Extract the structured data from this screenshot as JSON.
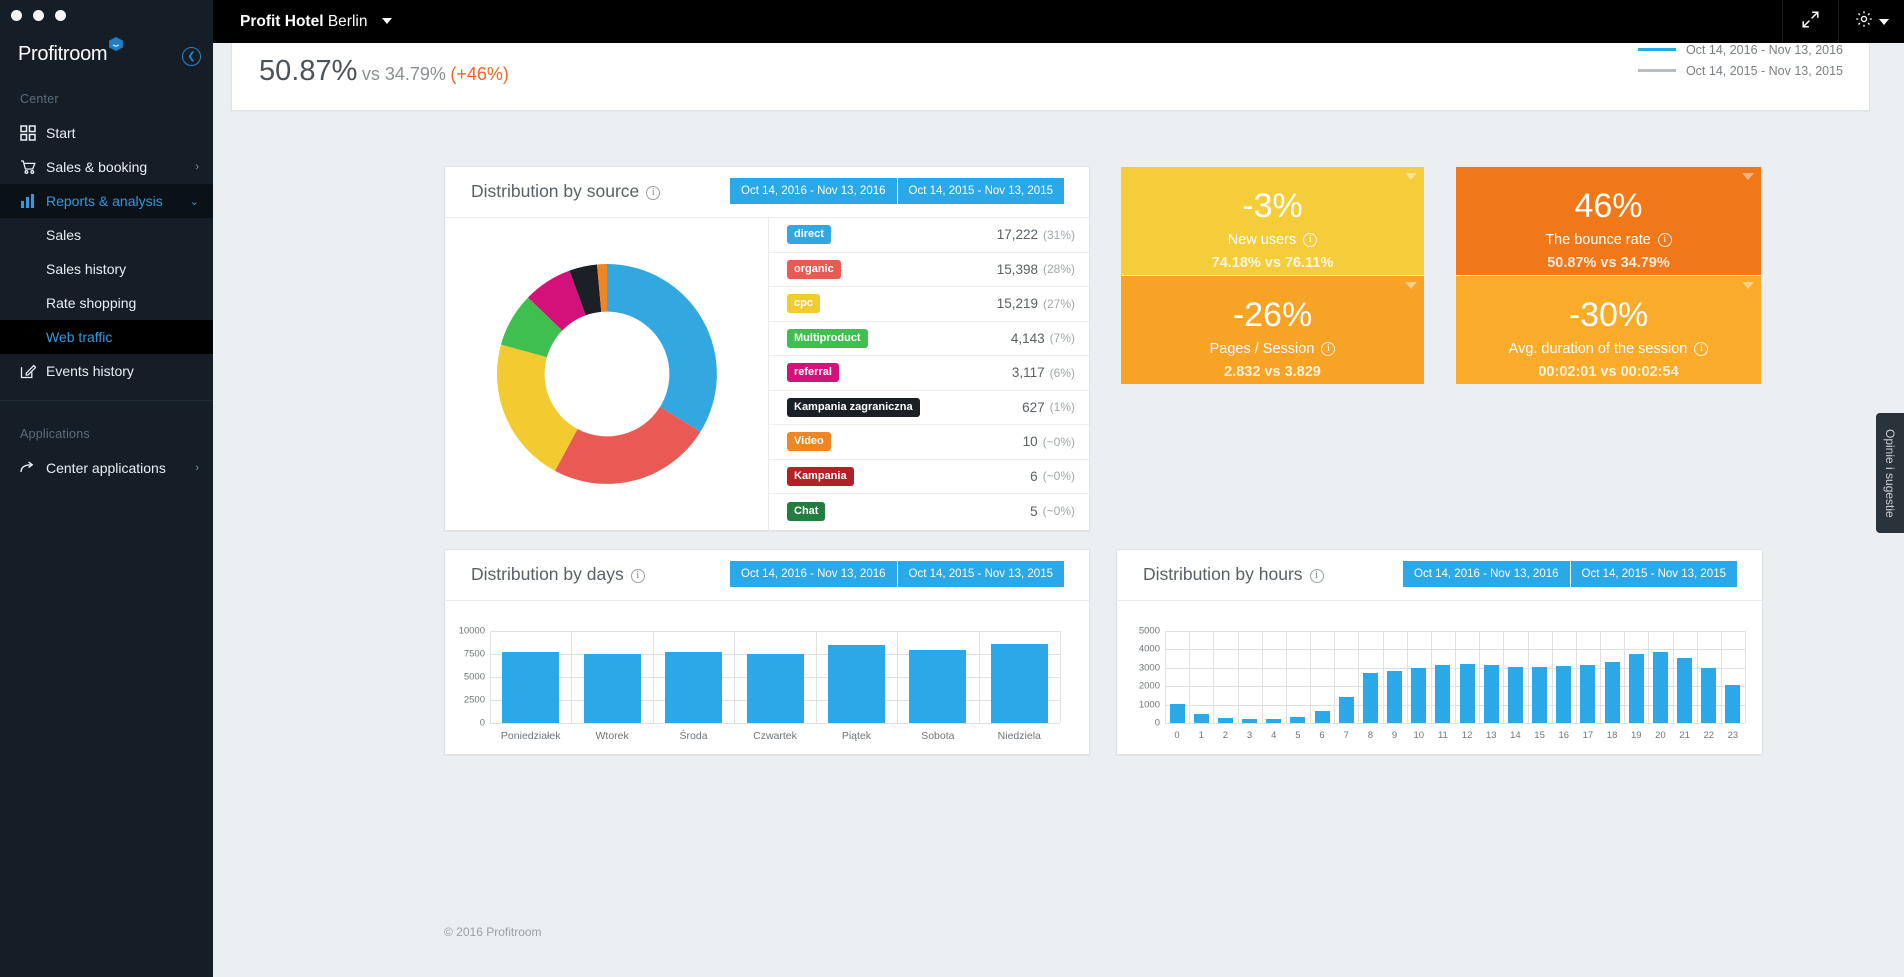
{
  "window": {
    "dots": 3
  },
  "sidebar": {
    "brand": "Profitroom",
    "collapse_icon": "chevron-left-icon",
    "sections": [
      {
        "label": "Center",
        "items": [
          {
            "label": "Start",
            "icon": "grid-icon",
            "chevron": ""
          },
          {
            "label": "Sales & booking",
            "icon": "cart-icon",
            "chevron": "›"
          },
          {
            "label": "Reports & analysis",
            "icon": "bar-chart-icon",
            "chevron": "⌄",
            "active": true,
            "children": [
              {
                "label": "Sales"
              },
              {
                "label": "Sales history"
              },
              {
                "label": "Rate shopping"
              },
              {
                "label": "Web traffic",
                "active": true
              }
            ]
          },
          {
            "label": "Events history",
            "icon": "edit-icon",
            "chevron": ""
          }
        ]
      },
      {
        "label": "Applications",
        "items": [
          {
            "label": "Center applications",
            "icon": "arrow-right-icon",
            "chevron": "›"
          }
        ]
      }
    ]
  },
  "topbar": {
    "hotel_bold": "Profit Hotel",
    "hotel_light": "Berlin",
    "expand_icon": "expand-arrows-icon",
    "settings_icon": "gear-icon"
  },
  "topcard": {
    "value": "50.87%",
    "vs": "vs 34.79%",
    "delta": "(+46%)",
    "legend": [
      {
        "label": "Oct 14, 2016 - Nov 13, 2016",
        "color": "#2ba8e8"
      },
      {
        "label": "Oct 14, 2015 - Nov 13, 2015",
        "color": "#b9bdc0"
      }
    ]
  },
  "source_panel": {
    "title": "Distribution by source",
    "info_icon": "info-icon",
    "ranges": [
      "Oct 14, 2016 - Nov 13, 2016",
      "Oct 14, 2015 - Nov 13, 2015"
    ],
    "rows": [
      {
        "label": "direct",
        "color": "#33a8e0",
        "value": "17,222",
        "pct": "(31%)"
      },
      {
        "label": "organic",
        "color": "#ea5a54",
        "value": "15,398",
        "pct": "(28%)"
      },
      {
        "label": "cpc",
        "color": "#f2cb30",
        "value": "15,219",
        "pct": "(27%)"
      },
      {
        "label": "Multiproduct",
        "color": "#3fbf4f",
        "value": "4,143",
        "pct": "(7%)"
      },
      {
        "label": "referral",
        "color": "#d4117a",
        "value": "3,117",
        "pct": "(6%)"
      },
      {
        "label": "Kampania zagraniczna",
        "color": "#1b2026",
        "value": "627",
        "pct": "(1%)"
      },
      {
        "label": "Video",
        "color": "#f08524",
        "value": "10",
        "pct": "(~0%)"
      },
      {
        "label": "Kampania",
        "color": "#b32025",
        "value": "6",
        "pct": "(~0%)"
      },
      {
        "label": "Chat",
        "color": "#237d41",
        "value": "5",
        "pct": "(~0%)"
      }
    ]
  },
  "chart_data": [
    {
      "type": "pie",
      "title": "Distribution by source",
      "legend_position": "right",
      "labels": [
        "direct",
        "organic",
        "cpc",
        "Multiproduct",
        "referral",
        "Kampania zagraniczna",
        "Video",
        "Kampania",
        "Chat"
      ],
      "values": [
        17222,
        15398,
        15219,
        4143,
        3117,
        627,
        10,
        6,
        5
      ],
      "percents": [
        31,
        28,
        27,
        7,
        6,
        1,
        0,
        0,
        0
      ],
      "colors": [
        "#33a8e0",
        "#ea5a54",
        "#f2cb30",
        "#3fbf4f",
        "#d4117a",
        "#1b2026",
        "#f08524",
        "#b32025",
        "#237d41"
      ]
    },
    {
      "type": "bar",
      "title": "Distribution by days",
      "categories": [
        "Poniedziałek",
        "Wtorek",
        "Środa",
        "Czwartek",
        "Piątek",
        "Sobota",
        "Niedziela"
      ],
      "values": [
        7700,
        7450,
        7750,
        7530,
        8500,
        7950,
        8550
      ],
      "ylabel": "",
      "xlabel": "",
      "ylim": [
        0,
        10000
      ],
      "yticks": [
        0,
        2500,
        5000,
        7500,
        10000
      ],
      "grid": true,
      "color": "#2ba8e8"
    },
    {
      "type": "bar",
      "title": "Distribution by hours",
      "categories": [
        "0",
        "1",
        "2",
        "3",
        "4",
        "5",
        "6",
        "7",
        "8",
        "9",
        "10",
        "11",
        "12",
        "13",
        "14",
        "15",
        "16",
        "17",
        "18",
        "19",
        "20",
        "21",
        "22",
        "23"
      ],
      "values": [
        1020,
        470,
        270,
        200,
        200,
        330,
        670,
        1420,
        2730,
        2830,
        2970,
        3130,
        3210,
        3130,
        3060,
        3070,
        3090,
        3150,
        3290,
        3740,
        3840,
        3530,
        2970,
        2090
      ],
      "ylabel": "",
      "xlabel": "",
      "ylim": [
        0,
        5000
      ],
      "yticks": [
        0,
        1000,
        2000,
        3000,
        4000,
        5000
      ],
      "grid": true,
      "color": "#2ba8e8"
    }
  ],
  "kpis": [
    {
      "pct": "-3%",
      "name": "New users",
      "cmp": "74.18% vs 76.11%",
      "bg": "#f5cc3a",
      "info_icon": "info-icon"
    },
    {
      "pct": "46%",
      "name": "The bounce rate",
      "cmp": "50.87% vs 34.79%",
      "bg": "#f07818",
      "info_icon": "info-icon"
    },
    {
      "pct": "-26%",
      "name": "Pages / Session",
      "cmp": "2.832 vs 3.829",
      "bg": "#f7a325",
      "info_icon": "info-icon"
    },
    {
      "pct": "-30%",
      "name": "Avg. duration of the session",
      "cmp": "00:02:01 vs 00:02:54",
      "bg": "#f9ab29",
      "info_icon": "info-icon"
    }
  ],
  "days_panel": {
    "title": "Distribution by days",
    "info_icon": "info-icon",
    "ranges": [
      "Oct 14, 2016 - Nov 13, 2016",
      "Oct 14, 2015 - Nov 13, 2015"
    ]
  },
  "hours_panel": {
    "title": "Distribution by hours",
    "info_icon": "info-icon",
    "ranges": [
      "Oct 14, 2016 - Nov 13, 2016",
      "Oct 14, 2015 - Nov 13, 2015"
    ]
  },
  "footer": {
    "text": "© 2016 Profitroom"
  },
  "feedback": {
    "text": "Opinie i sugestie"
  }
}
